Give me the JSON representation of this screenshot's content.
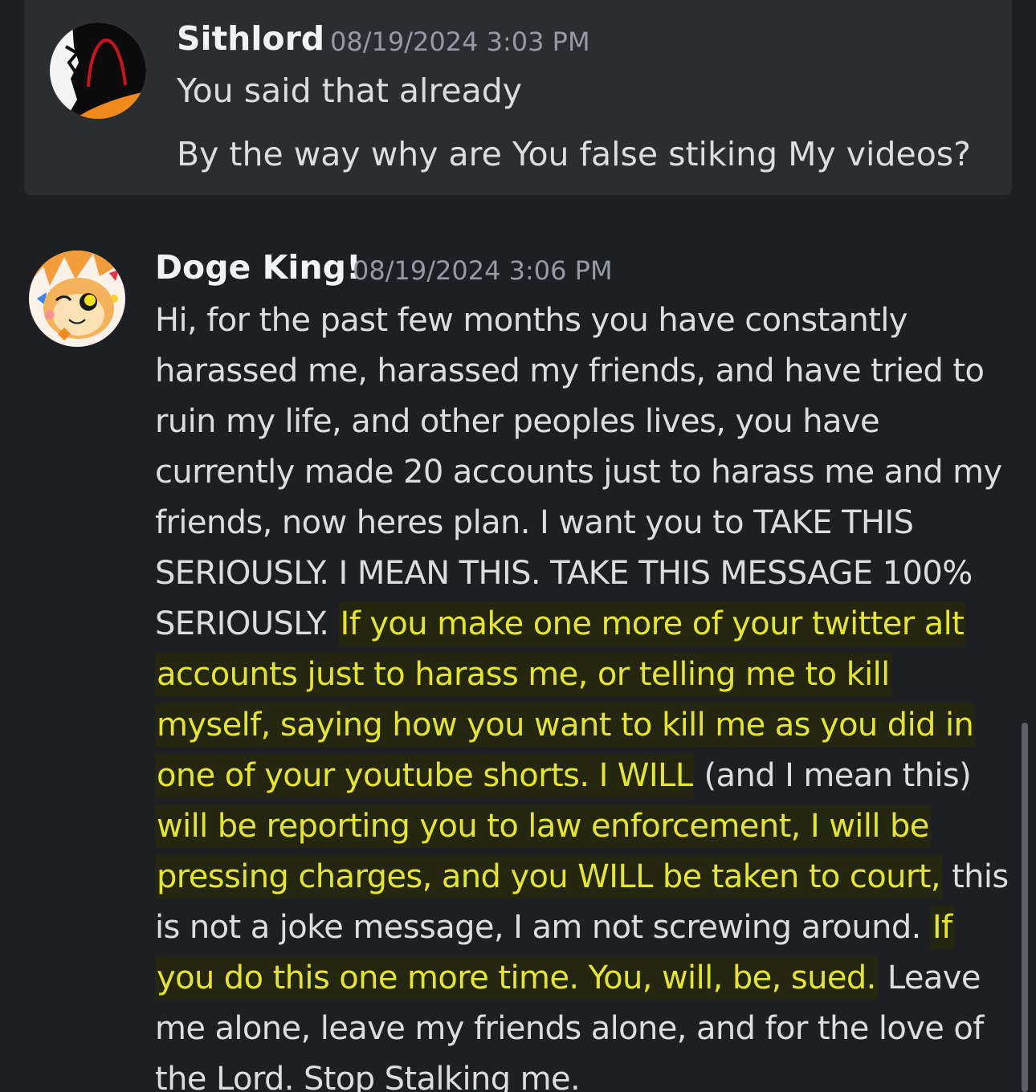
{
  "messages": [
    {
      "username": "Sithlord",
      "timestamp": "08/19/2024 3:03 PM",
      "lines": [
        "You said that already",
        "By the way why are You false stiking My videos?"
      ]
    },
    {
      "username": "Doge King!",
      "timestamp": "08/19/2024 3:06 PM",
      "segments": [
        {
          "text": "Hi, for the past few months you have constantly harassed me, harassed my friends, and have tried to ruin my life, and other peoples lives, you have currently made 20 accounts just to harass me and my friends, now heres plan. I want you to TAKE THIS SERIOUSLY. I MEAN THIS. TAKE THIS MESSAGE 100% SERIOUSLY. "
        },
        {
          "text": "If you make one more of your twitter alt accounts just to harass me, or telling me to kill myself, saying how you want to kill me as you did in one of your youtube shorts. I WILL"
        },
        {
          "text": " (and I mean this) "
        },
        {
          "text": "will be reporting you to law enforcement, I will be pressing charges, and you WILL be taken to court,"
        },
        {
          "text": " this is not a joke message, I am not screwing around. "
        },
        {
          "text": "If you do this one more time. You, will, be, sued."
        },
        {
          "text": " Leave me alone, leave my friends alone, and for the love of the Lord. Stop Stalking me."
        }
      ]
    }
  ],
  "colors": {
    "background": "#1e1f22",
    "message_highlight_bg": "#2b2d31",
    "username": "#f2f3f5",
    "timestamp": "#949ba4",
    "text": "#dbdee1",
    "highlighter_text": "#e4e62c"
  }
}
